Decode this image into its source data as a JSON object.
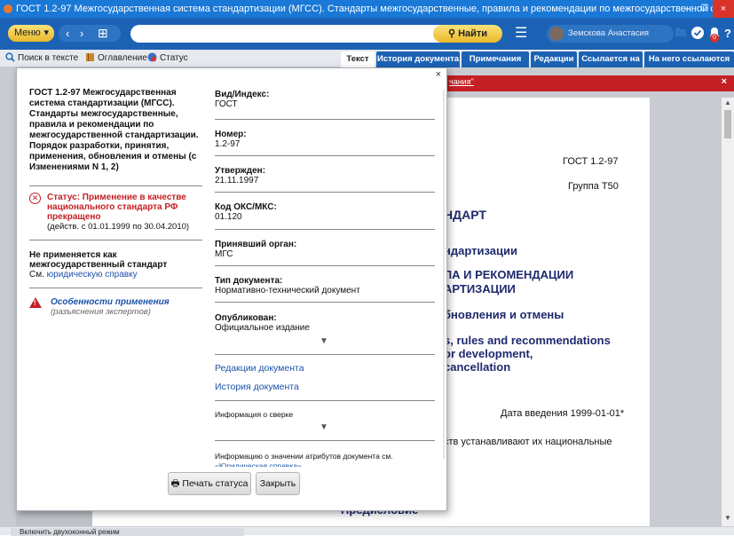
{
  "window": {
    "title": "ГОСТ 1.2-97 Межгосударственная система стандартизации (МГСС). Стандарты межгосударственные, правила и рекомендации по межгосударственной стандартизации. ...",
    "min": "–",
    "max": "☐",
    "close": "×"
  },
  "toolbar": {
    "menu_label": "Меню",
    "back": "‹",
    "forward": "›",
    "grid": "⊞",
    "search_placeholder": "",
    "find_label": "Найти",
    "user_name": "Земскова Анастасия",
    "notify_count": "0",
    "help": "?"
  },
  "subbar": {
    "search_in_text": "Поиск в тексте",
    "contents": "Оглавление",
    "status": "Статус"
  },
  "tabs": [
    {
      "label": "Текст",
      "active": true
    },
    {
      "label": "История документа"
    },
    {
      "label": "Примечания"
    },
    {
      "label": "Редакции"
    },
    {
      "label": "Ссылается на"
    },
    {
      "label": "На него ссылаются"
    }
  ],
  "redbar": {
    "link_fragment": "чания\"",
    "close": "×"
  },
  "document": {
    "gost_number": "ГОСТ 1.2-97",
    "group": "Группа Т50",
    "h1": "НДАРТ",
    "h2": "ндартизации",
    "h3a": "ЛА И РЕКОМЕНДАЦИИ",
    "h3b": "АРТИЗАЦИИ",
    "h4": "бновления и отмены",
    "en1": "s, rules and recommendations",
    "en2": "or development,",
    "en3": "cancellation",
    "intro_date": "Дата введения 1999-01-01*",
    "body_line": "ств устанавливают их национальные",
    "preface": "Предисловие"
  },
  "dialog": {
    "close": "×",
    "doc_title": "ГОСТ 1.2-97 Межгосударственная система стандартизации (МГСС). Стандарты межгосударственные, правила и рекомендации по межгосударственной стандартизации. Порядок разработки, принятия, применения, обновления и отмены (с Изменениями N 1, 2)",
    "status_text": "Статус: Применение в качестве национального стандарта РФ прекращено",
    "status_dates": "(действ. с 01.01.1999 по 30.04.2010)",
    "not_applied": "Не применяется как межгосударственный стандарт",
    "see": "См.",
    "legal_ref": "юридическую справку",
    "features_title": "Особенности применения",
    "features_sub": "(разъяснения экспертов)",
    "attrs": {
      "type_label": "Вид/Индекс:",
      "type_value": "ГОСТ",
      "number_label": "Номер:",
      "number_value": "1.2-97",
      "approved_label": "Утвержден:",
      "approved_value": "21.11.1997",
      "oks_label": "Код ОКС/МКС:",
      "oks_value": "01.120",
      "body_label": "Принявший орган:",
      "body_value": "МГС",
      "doctype_label": "Тип документа:",
      "doctype_value": "Нормативно-технический документ",
      "published_label": "Опубликован:",
      "published_value": "Официальное издание",
      "expand": "▼"
    },
    "links": {
      "editions": "Редакции документа",
      "history": "История документа"
    },
    "reconcile_label": "Информация о сверке",
    "attrinfo_label": "Информацию о значении атрибутов документа см.",
    "attrinfo_link": "«Юридическая справка»",
    "print_label": "Печать статуса",
    "close_label": "Закрыть"
  },
  "statusbar": {
    "dual_window": "Включить двухоконный режим"
  }
}
